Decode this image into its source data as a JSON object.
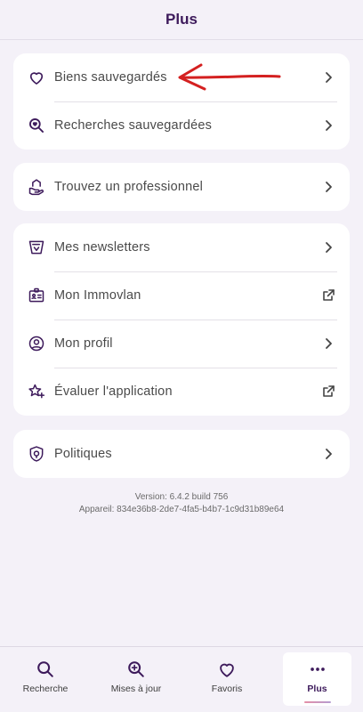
{
  "header": {
    "title": "Plus"
  },
  "groups": [
    {
      "items": [
        {
          "label": "Biens sauvegardés",
          "icon": "heart-icon",
          "trailing": "chevron"
        },
        {
          "label": "Recherches sauvegardées",
          "icon": "search-heart-icon",
          "trailing": "chevron"
        }
      ]
    },
    {
      "items": [
        {
          "label": "Trouvez un professionnel",
          "icon": "home-hand-icon",
          "trailing": "chevron"
        }
      ]
    },
    {
      "items": [
        {
          "label": "Mes newsletters",
          "icon": "newsletter-icon",
          "trailing": "chevron"
        },
        {
          "label": "Mon Immovlan",
          "icon": "id-card-icon",
          "trailing": "external-link"
        },
        {
          "label": "Mon profil",
          "icon": "user-circle-icon",
          "trailing": "chevron"
        },
        {
          "label": "Évaluer l'application",
          "icon": "star-sparkle-icon",
          "trailing": "external-link"
        }
      ]
    },
    {
      "items": [
        {
          "label": "Politiques",
          "icon": "shield-icon",
          "trailing": "chevron"
        }
      ]
    }
  ],
  "footer": {
    "version": "Version: 6.4.2 build 756",
    "device": "Appareil: 834e36b8-2de7-4fa5-b4b7-1c9d31b89e64"
  },
  "tabbar": {
    "tabs": [
      {
        "label": "Recherche",
        "icon": "search-icon",
        "active": false
      },
      {
        "label": "Mises à jour",
        "icon": "search-plus-icon",
        "active": false
      },
      {
        "label": "Favoris",
        "icon": "heart-icon",
        "active": false
      },
      {
        "label": "Plus",
        "icon": "more-dots-icon",
        "active": true
      }
    ]
  },
  "colors": {
    "background": "#f4f1f8",
    "brand": "#3d1a5b",
    "annotation_arrow": "#d42020"
  }
}
